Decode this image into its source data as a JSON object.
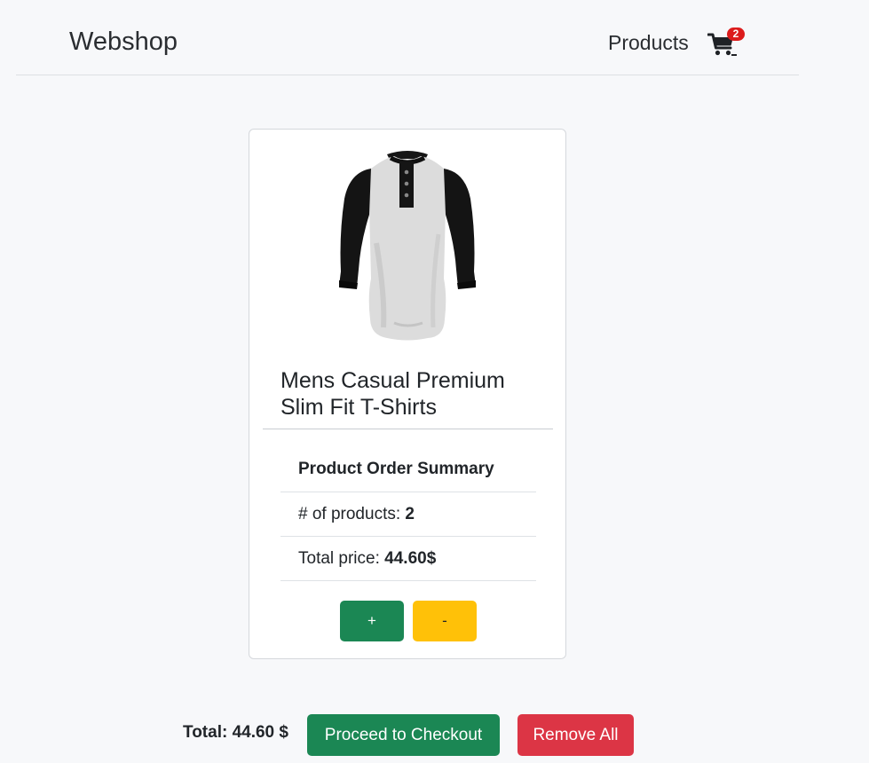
{
  "navbar": {
    "brand": "Webshop",
    "products_link": "Products",
    "cart_icon": "cart-icon",
    "cart_count": "2"
  },
  "product": {
    "image_icon": "raglan-henley-shirt-image",
    "title": "Mens Casual Premium Slim Fit T-Shirts",
    "summary": {
      "heading": "Product Order Summary",
      "count_label": "# of products: ",
      "count_value": "2",
      "price_label": "Total price: ",
      "price_value": "44.60$"
    },
    "plus_label": "+",
    "minus_label": "-"
  },
  "footer": {
    "total": "Total: 44.60 $",
    "checkout_label": "Proceed to Checkout",
    "remove_all_label": "Remove All"
  },
  "colors": {
    "success": "#1b8754",
    "warning": "#ffc108",
    "danger": "#dc3545",
    "badge": "#dc1c1c",
    "background": "#f7f8fa"
  }
}
